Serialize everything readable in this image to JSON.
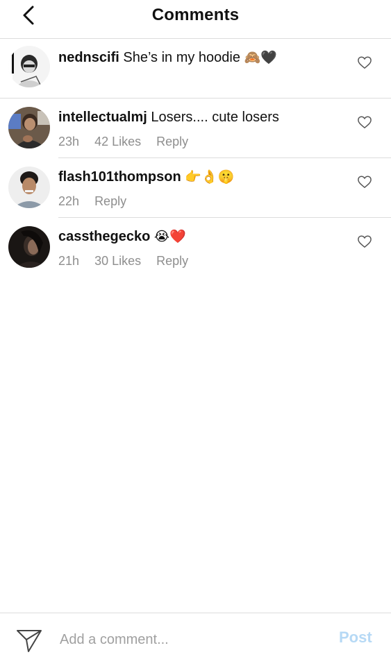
{
  "header": {
    "title": "Comments"
  },
  "comments": [
    {
      "username": "nednscifi",
      "text": "She’s in my hoodie",
      "emoji": "🙈🖤",
      "time": "",
      "likes": "",
      "reply": ""
    },
    {
      "username": "intellectualmj",
      "text": "Losers.... cute losers",
      "emoji": "",
      "time": "23h",
      "likes": "42 Likes",
      "reply": "Reply"
    },
    {
      "username": "flash101thompson",
      "text": "",
      "emoji": "👉👌🤫",
      "time": "22h",
      "likes": "",
      "reply": "Reply"
    },
    {
      "username": "cassthegecko",
      "text": "",
      "emoji": "😭❤️",
      "time": "21h",
      "likes": "30 Likes",
      "reply": "Reply"
    }
  ],
  "composer": {
    "placeholder": "Add a comment...",
    "post_label": "Post"
  },
  "icons": {
    "back": "chevron-left-icon",
    "like": "heart-outline-icon",
    "send": "paper-plane-icon"
  },
  "colors": {
    "post_disabled": "#b6d9f5",
    "meta_gray": "#8e8e8e",
    "divider": "#dcdcdc"
  }
}
